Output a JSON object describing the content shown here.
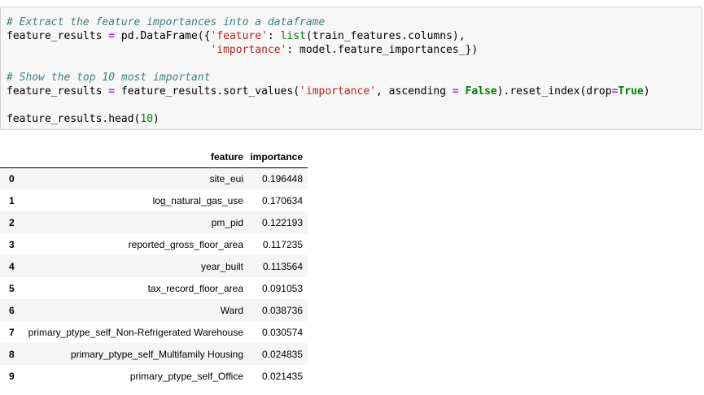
{
  "code_cell": {
    "comment1": "# Extract the feature importances into a dataframe",
    "line1a": "feature_results ",
    "line1b": " pd.DataFrame({",
    "line1c": "'feature'",
    "line1d": ": ",
    "line1e": "list",
    "line1f": "(train_features.columns),",
    "line2a": "                                ",
    "line2b": "'importance'",
    "line2c": ": model.feature_importances_})",
    "comment2": "# Show the top 10 most important",
    "line3a": "feature_results ",
    "line3b": " feature_results.sort_values(",
    "line3c": "'importance'",
    "line3d": ", ascending ",
    "line3e": "False",
    "line3f": ").reset_index(drop",
    "line3g": "True",
    "line3h": ")",
    "line4a": "feature_results.head(",
    "line4b": "10",
    "line4c": ")",
    "assign_op": "=",
    "colors": {
      "comment": "#408080",
      "operator": "#aa22ff",
      "string": "#ba2121",
      "keyword": "#008000"
    }
  },
  "output_table": {
    "columns": [
      "feature",
      "importance"
    ],
    "rows": [
      {
        "index": "0",
        "feature": "site_eui",
        "importance": "0.196448"
      },
      {
        "index": "1",
        "feature": "log_natural_gas_use",
        "importance": "0.170634"
      },
      {
        "index": "2",
        "feature": "pm_pid",
        "importance": "0.122193"
      },
      {
        "index": "3",
        "feature": "reported_gross_floor_area",
        "importance": "0.117235"
      },
      {
        "index": "4",
        "feature": "year_built",
        "importance": "0.113564"
      },
      {
        "index": "5",
        "feature": "tax_record_floor_area",
        "importance": "0.091053"
      },
      {
        "index": "6",
        "feature": "Ward",
        "importance": "0.038736"
      },
      {
        "index": "7",
        "feature": "primary_ptype_self_Non-Refrigerated Warehouse",
        "importance": "0.030574"
      },
      {
        "index": "8",
        "feature": "primary_ptype_self_Multifamily Housing",
        "importance": "0.024835"
      },
      {
        "index": "9",
        "feature": "primary_ptype_self_Office",
        "importance": "0.021435"
      }
    ]
  }
}
